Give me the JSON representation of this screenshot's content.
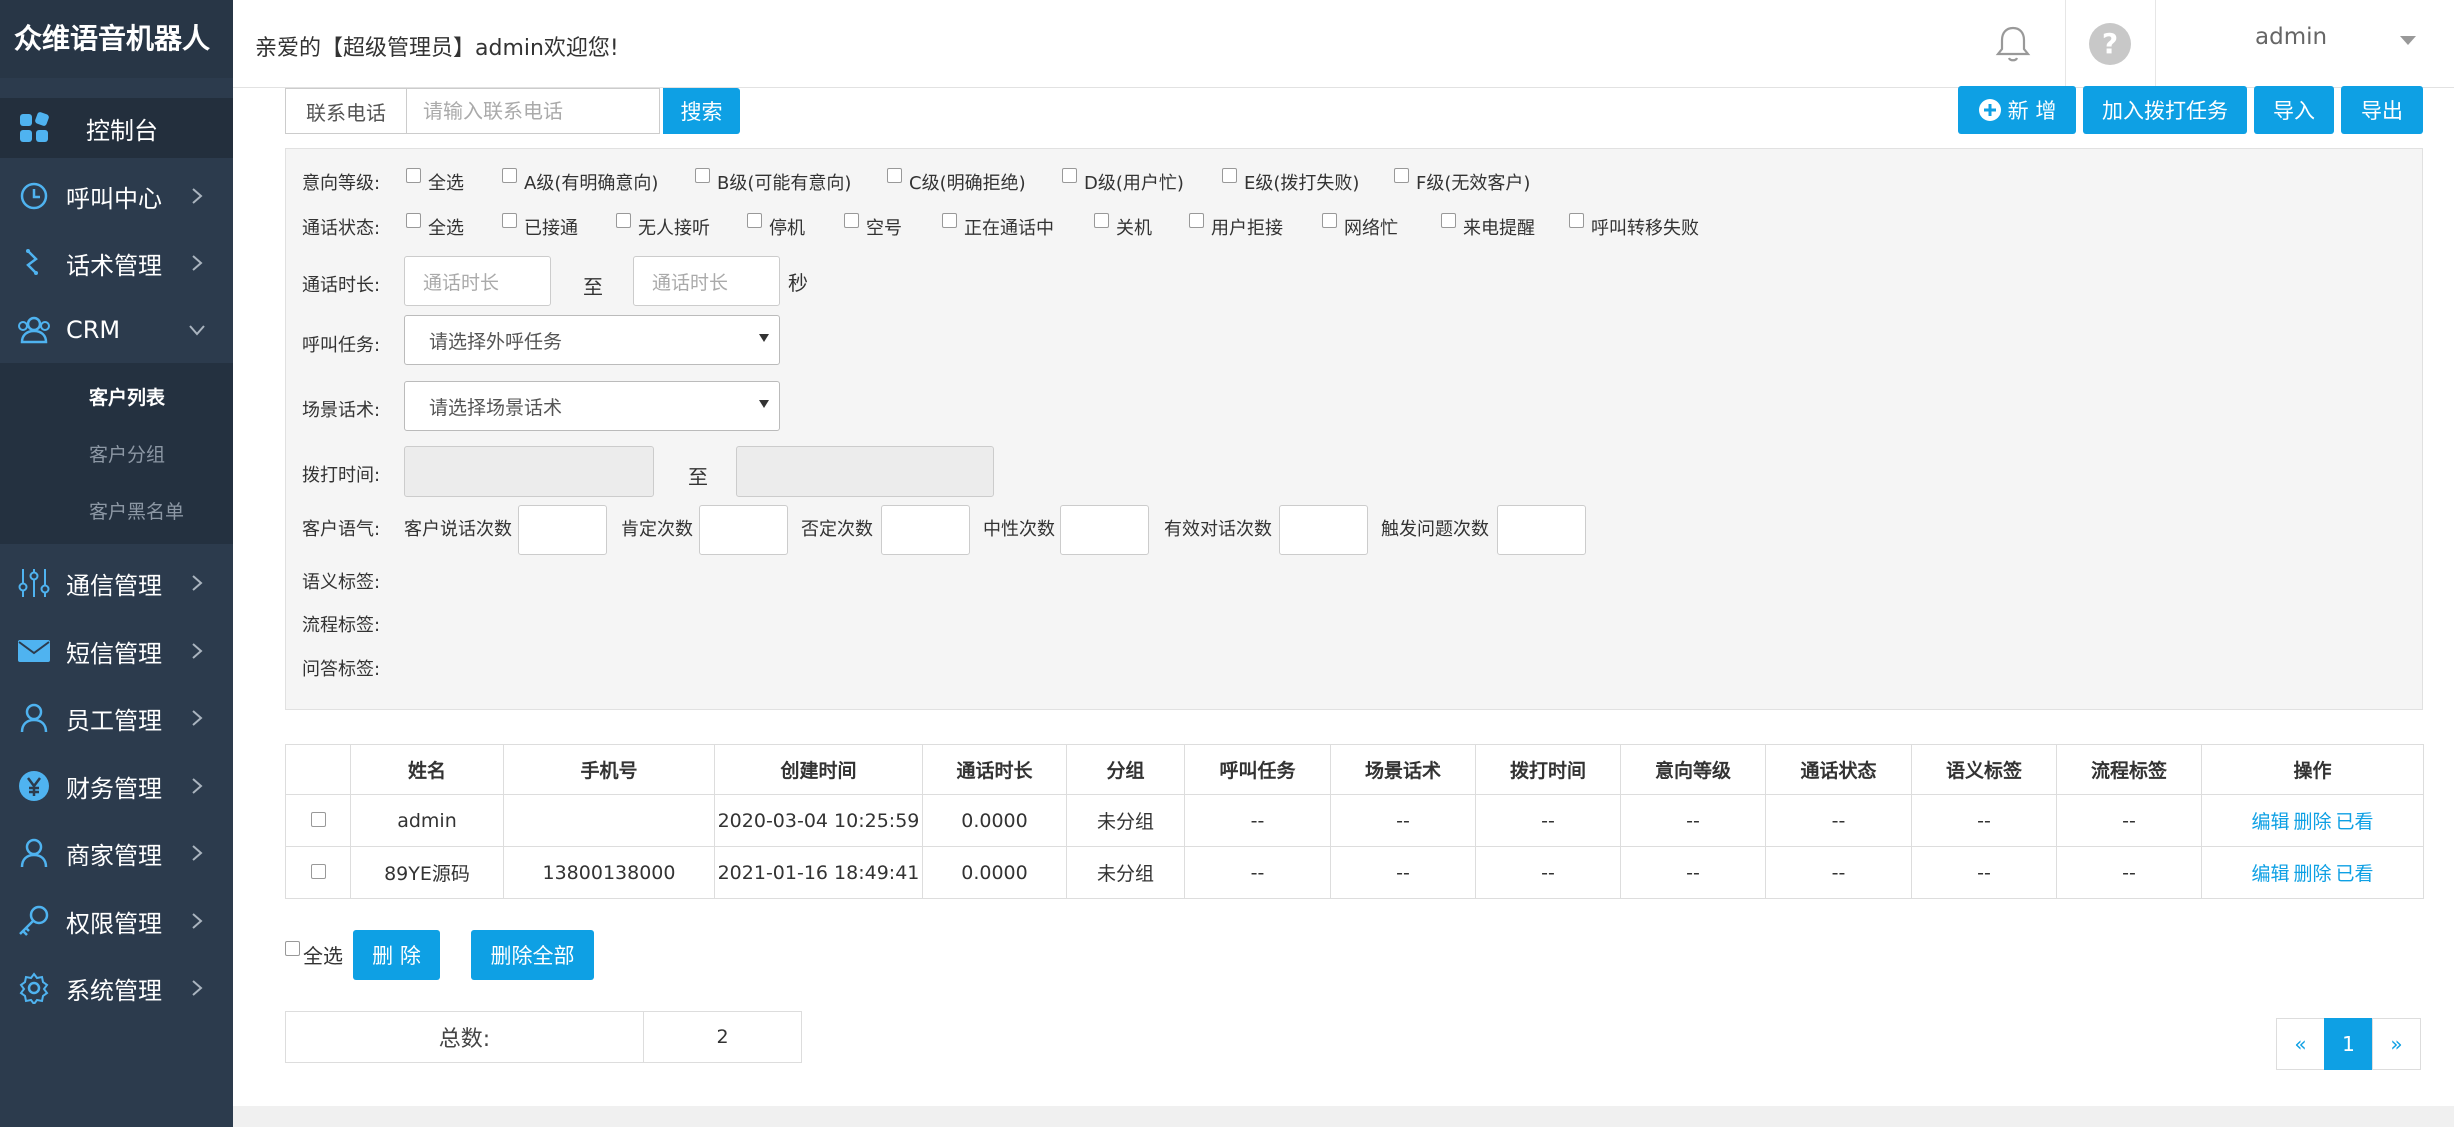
{
  "app_title": "众维语音机器人",
  "header": {
    "welcome": "亲爱的【超级管理员】admin欢迎您!",
    "user": "admin"
  },
  "sidebar": {
    "items": [
      {
        "label": "控制台",
        "icon": "dashboard-icon"
      },
      {
        "label": "呼叫中心",
        "icon": "clock-icon"
      },
      {
        "label": "话术管理",
        "icon": "script-icon"
      },
      {
        "label": "CRM",
        "icon": "users-icon"
      },
      {
        "label": "通信管理",
        "icon": "sliders-icon"
      },
      {
        "label": "短信管理",
        "icon": "mail-icon"
      },
      {
        "label": "员工管理",
        "icon": "person-icon"
      },
      {
        "label": "财务管理",
        "icon": "yen-icon"
      },
      {
        "label": "商家管理",
        "icon": "merchant-icon"
      },
      {
        "label": "权限管理",
        "icon": "key-icon"
      },
      {
        "label": "系统管理",
        "icon": "gear-icon"
      }
    ],
    "crm_sub": [
      "客户列表",
      "客户分组",
      "客户黑名单"
    ]
  },
  "toolbar": {
    "phone_label": "联系电话",
    "phone_placeholder": "请输入联系电话",
    "search": "搜索",
    "add": "新 增",
    "add_to_task": "加入拨打任务",
    "import": "导入",
    "export": "导出"
  },
  "filters": {
    "intent_label": "意向等级:",
    "intent_options": [
      "全选",
      "A级(有明确意向)",
      "B级(可能有意向)",
      "C级(明确拒绝)",
      "D级(用户忙)",
      "E级(拨打失败)",
      "F级(无效客户)"
    ],
    "call_status_label": "通话状态:",
    "call_status_options": [
      "全选",
      "已接通",
      "无人接听",
      "停机",
      "空号",
      "正在通话中",
      "关机",
      "用户拒接",
      "网络忙",
      "来电提醒",
      "呼叫转移失败"
    ],
    "duration_label": "通话时长:",
    "duration_placeholder": "通话时长",
    "to": "至",
    "seconds": "秒",
    "task_label": "呼叫任务:",
    "task_placeholder": "请选择外呼任务",
    "scene_label": "场景话术:",
    "scene_placeholder": "请选择场景话术",
    "dial_time_label": "拨打时间:",
    "tone_label": "客户语气:",
    "tone_fields": [
      "客户说话次数",
      "肯定次数",
      "否定次数",
      "中性次数",
      "有效对话次数",
      "触发问题次数"
    ],
    "semantic_label": "语义标签:",
    "flow_label": "流程标签:",
    "qa_label": "问答标签:"
  },
  "table": {
    "headers": [
      "姓名",
      "手机号",
      "创建时间",
      "通话时长",
      "分组",
      "呼叫任务",
      "场景话术",
      "拨打时间",
      "意向等级",
      "通话状态",
      "语义标签",
      "流程标签",
      "操作"
    ],
    "rows": [
      [
        "admin",
        "",
        "2020-03-04 10:25:59",
        "0.0000",
        "未分组",
        "--",
        "--",
        "--",
        "--",
        "--",
        "--",
        "--"
      ],
      [
        "89YE源码",
        "13800138000",
        "2021-01-16 18:49:41",
        "0.0000",
        "未分组",
        "--",
        "--",
        "--",
        "--",
        "--",
        "--",
        "--"
      ]
    ],
    "actions": [
      "编辑",
      "删除",
      "已看"
    ]
  },
  "bottom": {
    "select_all": "全选",
    "delete": "删 除",
    "delete_all": "删除全部",
    "total_label": "总数:",
    "total_value": "2"
  },
  "pager": {
    "prev": "«",
    "current": "1",
    "next": "»"
  },
  "colors": {
    "accent": "#0ea0e4",
    "sidebar": "#2c3b4d",
    "sidebar_icon": "#4fb3f0"
  }
}
